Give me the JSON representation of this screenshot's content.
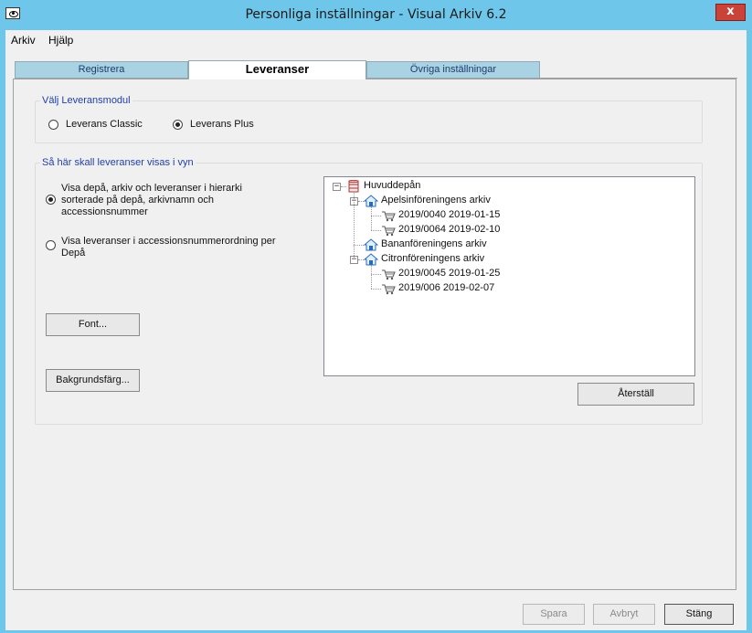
{
  "window": {
    "title": "Personliga inställningar - Visual Arkiv 6.2",
    "close_glyph": "x"
  },
  "menu": {
    "items": [
      "Arkiv",
      "Hjälp"
    ]
  },
  "tabs": [
    {
      "label": "Registrera",
      "active": false
    },
    {
      "label": "Leveranser",
      "active": true
    },
    {
      "label": "Övriga inställningar",
      "active": false
    }
  ],
  "module_group": {
    "title": "Välj Leveransmodul",
    "options": [
      {
        "label": "Leverans Classic",
        "checked": false
      },
      {
        "label": "Leverans Plus",
        "checked": true
      }
    ]
  },
  "view_group": {
    "title": "Så här skall leveranser visas i vyn",
    "options": [
      {
        "label": "Visa depå, arkiv och leveranser i hierarki sorterade på depå, arkivnamn och accessionsnummer",
        "checked": true
      },
      {
        "label": "Visa leveranser i accessionsnummerordning per Depå",
        "checked": false
      }
    ],
    "font_button": "Font...",
    "bgcolor_button": "Bakgrundsfärg...",
    "reset_button": "Återställ"
  },
  "tree": {
    "root": "Huvuddepån",
    "archives": [
      {
        "name": "Apelsinföreningens arkiv",
        "deliveries": [
          "2019/0040  2019-01-15",
          "2019/0064  2019-02-10"
        ]
      },
      {
        "name": "Bananföreningens arkiv",
        "deliveries": []
      },
      {
        "name": "Citronföreningens arkiv",
        "deliveries": [
          "2019/0045  2019-01-25",
          "2019/006  2019-02-07"
        ]
      }
    ]
  },
  "footer": {
    "save": "Spara",
    "cancel": "Avbryt",
    "close": "Stäng"
  },
  "icons": {
    "depot": "database-icon",
    "archive": "house-icon",
    "delivery": "cart-icon"
  },
  "colors": {
    "frame": "#6ec6ea",
    "close_button": "#c94338",
    "group_title": "#1f3fa8",
    "tab_inactive": "#a9d3e3"
  }
}
